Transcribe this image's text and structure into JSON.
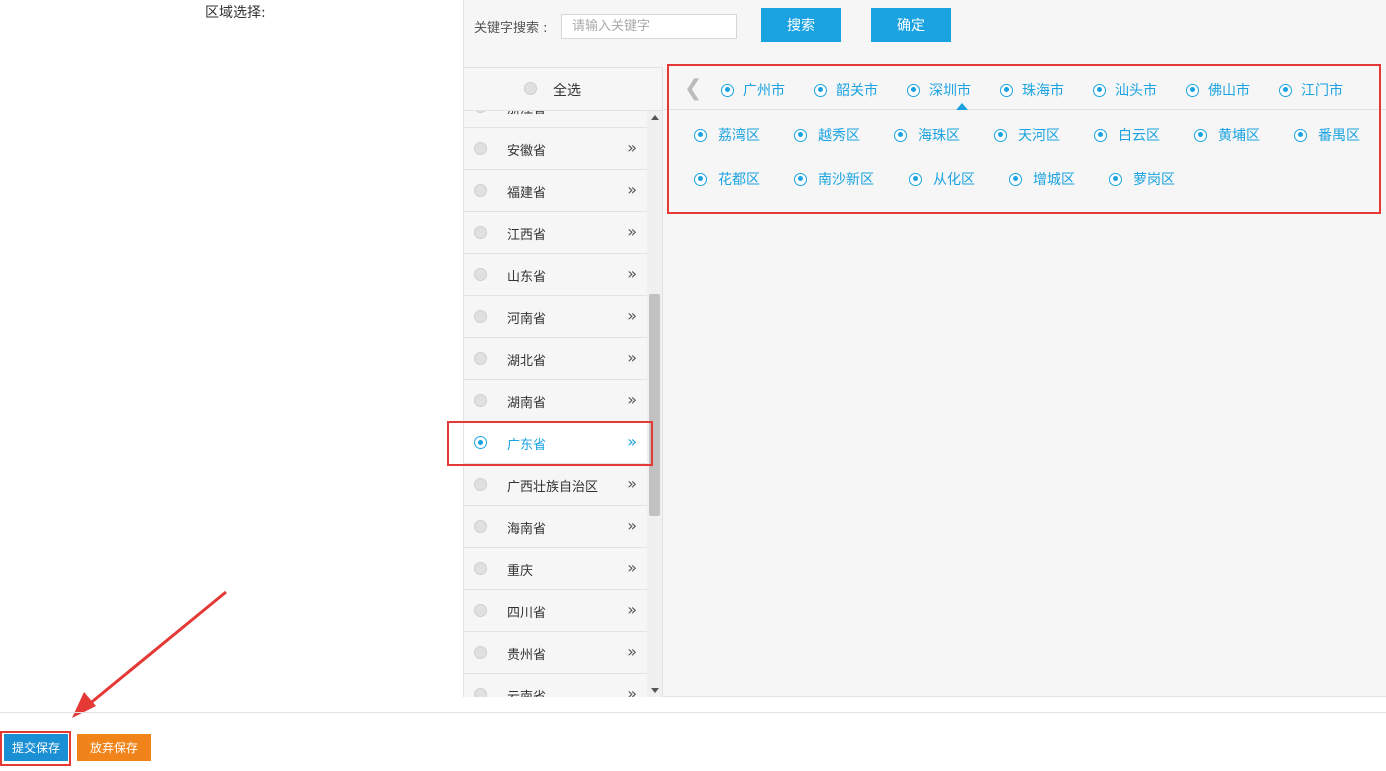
{
  "region_label": "区域选择:",
  "search": {
    "label": "关键字搜索 :",
    "placeholder": "请输入关键字",
    "value": "",
    "search_button": "搜索",
    "confirm_button": "确定"
  },
  "select_all_label": "全选",
  "provinces": [
    {
      "name": "浙江省",
      "selected": false
    },
    {
      "name": "安徽省",
      "selected": false
    },
    {
      "name": "福建省",
      "selected": false
    },
    {
      "name": "江西省",
      "selected": false
    },
    {
      "name": "山东省",
      "selected": false
    },
    {
      "name": "河南省",
      "selected": false
    },
    {
      "name": "湖北省",
      "selected": false
    },
    {
      "name": "湖南省",
      "selected": false
    },
    {
      "name": "广东省",
      "selected": true
    },
    {
      "name": "广西壮族自治区",
      "selected": false
    },
    {
      "name": "海南省",
      "selected": false
    },
    {
      "name": "重庆",
      "selected": false
    },
    {
      "name": "四川省",
      "selected": false
    },
    {
      "name": "贵州省",
      "selected": false
    },
    {
      "name": "云南省",
      "selected": false
    }
  ],
  "cities": [
    "广州市",
    "韶关市",
    "深圳市",
    "珠海市",
    "汕头市",
    "佛山市",
    "江门市"
  ],
  "active_city": "广州市",
  "districts": [
    "荔湾区",
    "越秀区",
    "海珠区",
    "天河区",
    "白云区",
    "黄埔区",
    "番禺区",
    "花都区",
    "南沙新区",
    "从化区",
    "增城区",
    "萝岗区"
  ],
  "footer": {
    "submit_button": "提交保存",
    "discard_button": "放弃保存"
  },
  "colors": {
    "accent_blue": "#1aa3e0",
    "submit_blue": "#1a8fd3",
    "discard_orange": "#f0841a",
    "annotation_red": "#e53935"
  }
}
